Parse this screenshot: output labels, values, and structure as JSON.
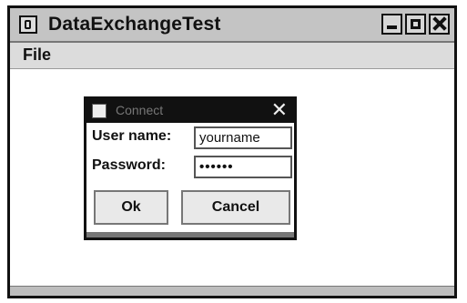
{
  "window": {
    "title": "DataExchangeTest"
  },
  "menu": {
    "file_label": "File"
  },
  "dialog": {
    "title": "Connect",
    "close_glyph": "✕",
    "username_label": "User name:",
    "username_value": "yourname",
    "password_label": "Password:",
    "password_masked": "••••••",
    "ok_label": "Ok",
    "cancel_label": "Cancel"
  },
  "icons": [
    "java-app-icon",
    "minimize-icon",
    "maximize-icon",
    "close-icon"
  ]
}
